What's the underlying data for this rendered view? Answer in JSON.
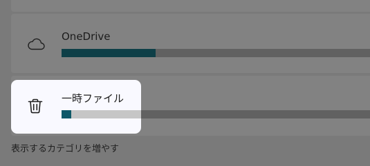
{
  "storage_categories": [
    {
      "label": "OneDrive",
      "icon": "cloud-icon",
      "usage_fraction": 0.29
    },
    {
      "label": "一時ファイル",
      "icon": "trash-icon",
      "usage_fraction": 0.03
    }
  ],
  "footer": {
    "show_more_label": "表示するカテゴリを増やす"
  },
  "colors": {
    "accent_fill": "#0e3f47",
    "accent_fill_highlight": "#0f5968",
    "track_dimmed": "#616161",
    "track_highlight": "#c6c6c6",
    "page_background": "#7a7a7a",
    "card_background": "#828282",
    "spotlight_background": "#f9f9ff"
  }
}
